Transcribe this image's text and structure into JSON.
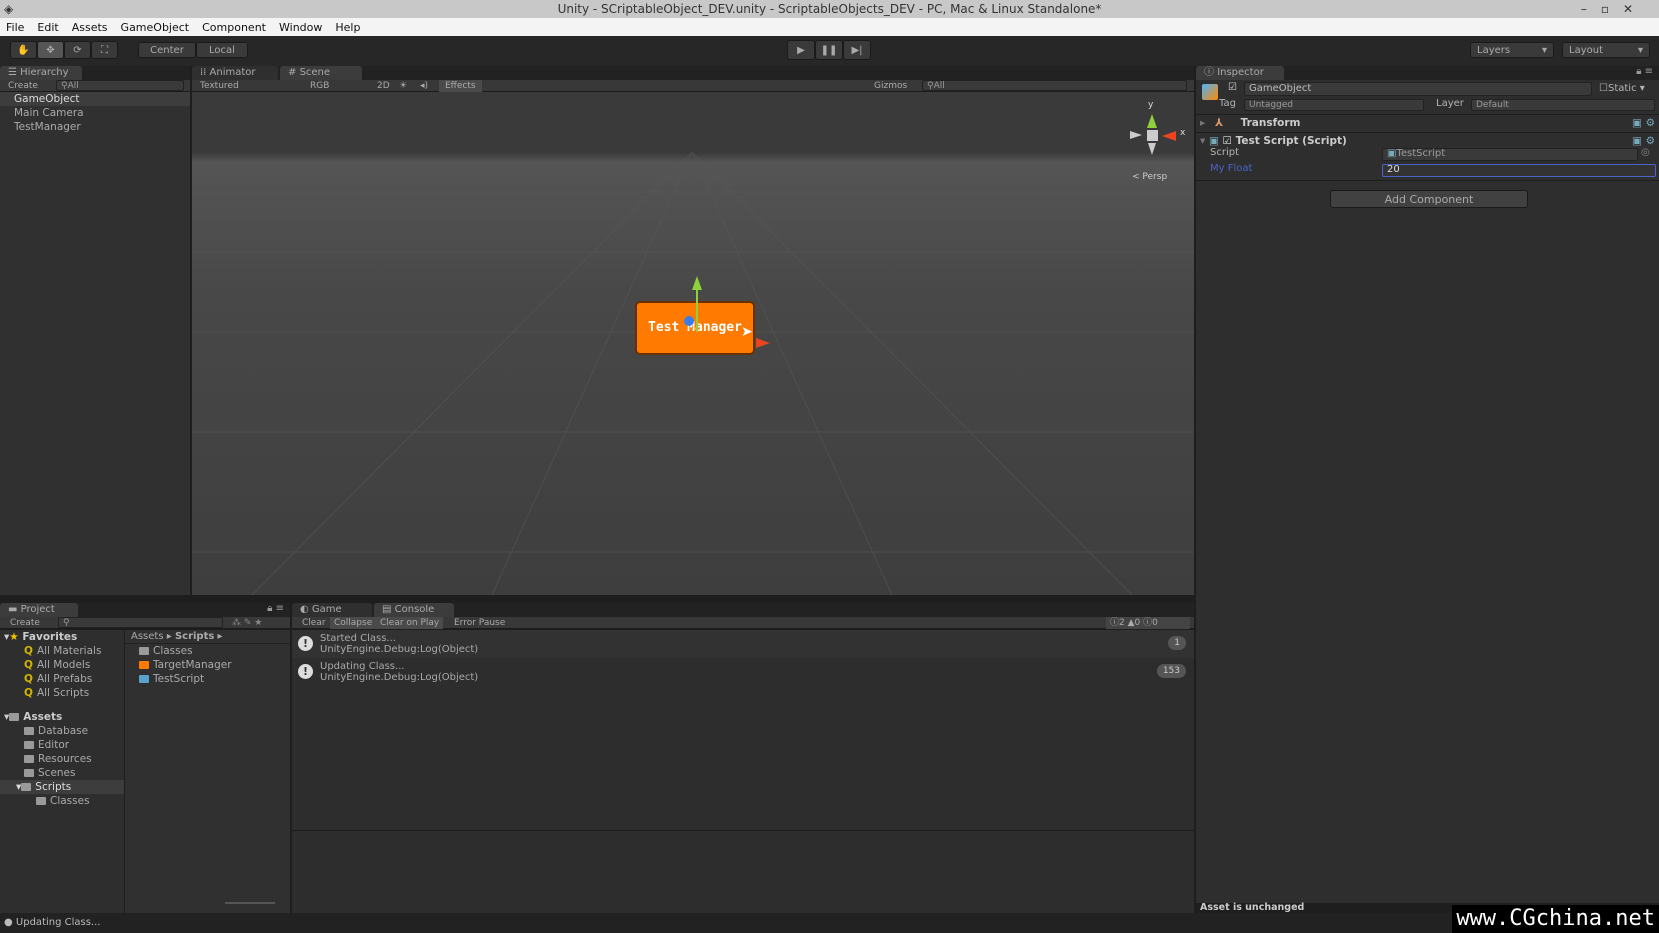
{
  "window": {
    "title": "Unity - SCriptableObject_DEV.unity - ScriptableObjects_DEV - PC, Mac & Linux Standalone*"
  },
  "menu": [
    "File",
    "Edit",
    "Assets",
    "GameObject",
    "Component",
    "Window",
    "Help"
  ],
  "toolbar": {
    "pivot": "Center",
    "space": "Local",
    "layers": "Layers",
    "layout": "Layout"
  },
  "hierarchy": {
    "tab": "Hierarchy",
    "create": "Create",
    "search": "All",
    "items": [
      "GameObject",
      "Main Camera",
      "TestManager"
    ]
  },
  "scene": {
    "tabs": [
      "Animator",
      "Scene"
    ],
    "shading": "Textured",
    "render": "RGB",
    "mode2d": "2D",
    "effects": "Effects",
    "gizmos": "Gizmos",
    "search": "All",
    "persp": "Persp",
    "object_label": "Test Manager",
    "axis_y": "y",
    "axis_x": "x"
  },
  "inspector": {
    "tab": "Inspector",
    "object_name": "GameObject",
    "static": "Static",
    "tag_label": "Tag",
    "tag": "Untagged",
    "layer_label": "Layer",
    "layer": "Default",
    "components": [
      {
        "name": "Transform"
      },
      {
        "name": "Test Script (Script)"
      }
    ],
    "script_label": "Script",
    "script_value": "TestScript",
    "float_label": "My Float",
    "float_value": "20",
    "add_component": "Add Component",
    "status": "Asset is unchanged"
  },
  "project": {
    "tab": "Project",
    "create": "Create",
    "favorites": "Favorites",
    "fav_items": [
      "All Materials",
      "All Models",
      "All Prefabs",
      "All Scripts"
    ],
    "assets": "Assets",
    "asset_items": [
      "Database",
      "Editor",
      "Resources",
      "Scenes",
      "Scripts"
    ],
    "sub_item": "Classes",
    "breadcrumb": [
      "Assets",
      "Scripts"
    ],
    "files": [
      "Classes",
      "TargetManager",
      "TestScript"
    ]
  },
  "console": {
    "tabs": [
      "Game",
      "Console"
    ],
    "buttons": [
      "Clear",
      "Collapse",
      "Clear on Play",
      "Error Pause"
    ],
    "counts": {
      "log": "2",
      "warn": "0",
      "error": "0"
    },
    "entries": [
      {
        "msg": "Started Class...",
        "trace": "UnityEngine.Debug:Log(Object)",
        "count": "1"
      },
      {
        "msg": "Updating Class...",
        "trace": "UnityEngine.Debug:Log(Object)",
        "count": "153"
      }
    ]
  },
  "statusbar": {
    "text": "Updating Class..."
  },
  "watermark": "www.CGchina.net",
  "colors": {
    "accent_orange": "#ff7a00",
    "selection_blue": "#4a63c8"
  }
}
